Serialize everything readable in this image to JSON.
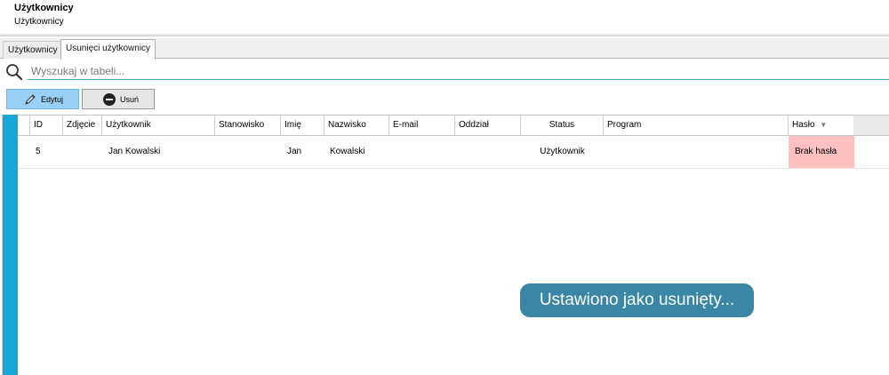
{
  "header": {
    "title": "Użytkownicy",
    "subtitle": "Użytkownicy"
  },
  "tabs": [
    {
      "label": "Użytkownicy",
      "active": false
    },
    {
      "label": "Usunięci użytkownicy",
      "active": true
    }
  ],
  "search": {
    "placeholder": "Wyszukaj w tabeli...",
    "value": ""
  },
  "toolbar": {
    "edit_label": "Edytuj",
    "delete_label": "Usuń"
  },
  "table": {
    "columns": [
      "ID",
      "Zdjęcie",
      "Użytkownik",
      "Stanowisko",
      "Imię",
      "Nazwisko",
      "E-mail",
      "Oddział",
      "Status",
      "Program",
      "Hasło"
    ],
    "sort_indicator": "▼",
    "rows": [
      {
        "id": "5",
        "photo": "",
        "user": "Jan Kowalski",
        "position": "",
        "first_name": "Jan",
        "last_name": "Kowalski",
        "email": "",
        "branch": "",
        "status": "Użytkownik",
        "program": "",
        "password": "Brak hasła"
      }
    ]
  },
  "toast": {
    "message": "Ustawiono jako usunięty..."
  },
  "colors": {
    "accent_bar": "#17a6d6",
    "edit_button": "#99d0f5",
    "password_missing": "#ffc0c0",
    "toast_bg": "#3a86a6"
  }
}
